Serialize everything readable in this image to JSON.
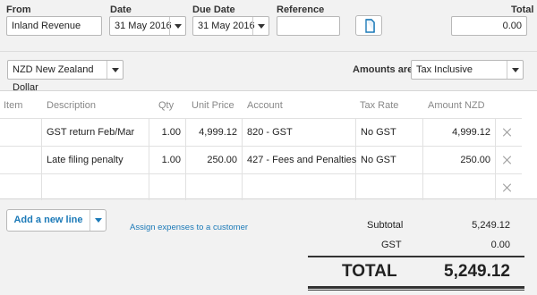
{
  "header": {
    "from_label": "From",
    "from_value": "Inland Revenue",
    "date_label": "Date",
    "date_value": "31 May 2016",
    "due_date_label": "Due Date",
    "due_date_value": "31 May 2016",
    "reference_label": "Reference",
    "reference_value": "",
    "total_label": "Total",
    "total_value": "0.00"
  },
  "options": {
    "currency": "NZD New Zealand Dollar",
    "amounts_are_label": "Amounts are",
    "amounts_are_value": "Tax Inclusive"
  },
  "table": {
    "columns": [
      "Item",
      "Description",
      "Qty",
      "Unit Price",
      "Account",
      "Tax Rate",
      "Amount NZD"
    ],
    "rows": [
      {
        "item": "",
        "description": "GST return Feb/Mar",
        "qty": "1.00",
        "unit_price": "4,999.12",
        "account": "820 - GST",
        "tax_rate": "No GST",
        "amount": "4,999.12"
      },
      {
        "item": "",
        "description": "Late filing penalty",
        "qty": "1.00",
        "unit_price": "250.00",
        "account": "427 - Fees and Penalties",
        "tax_rate": "No GST",
        "amount": "250.00"
      }
    ]
  },
  "actions": {
    "add_line": "Add a new line",
    "assign_link": "Assign expenses to a customer"
  },
  "totals": {
    "subtotal_label": "Subtotal",
    "subtotal_value": "5,249.12",
    "gst_label": "GST",
    "gst_value": "0.00",
    "total_label": "TOTAL",
    "total_value": "5,249.12"
  },
  "colors": {
    "link": "#1c7ab8",
    "button_text": "#1c7ab8"
  }
}
